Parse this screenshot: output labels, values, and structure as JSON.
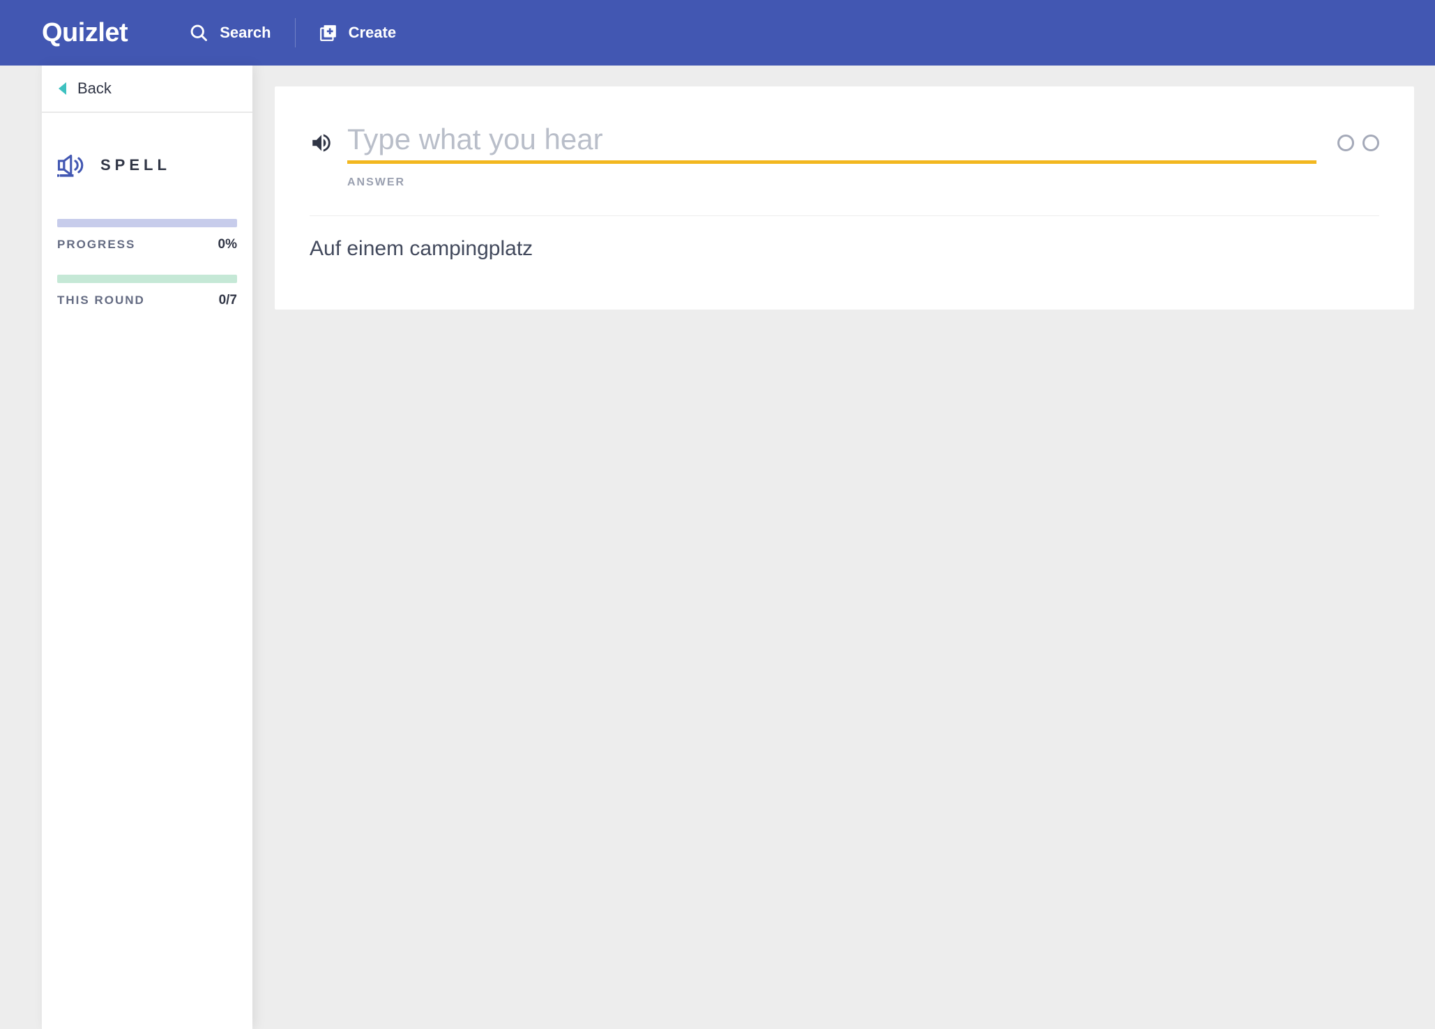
{
  "header": {
    "logo": "Quizlet",
    "search_label": "Search",
    "create_label": "Create"
  },
  "sidebar": {
    "back_label": "Back",
    "mode_label": "SPELL",
    "progress_label": "PROGRESS",
    "progress_value": "0%",
    "round_label": "THIS ROUND",
    "round_value": "0/7"
  },
  "main": {
    "placeholder": "Type what you hear",
    "answer_label": "ANSWER",
    "prompt": "Auf einem campingplatz"
  }
}
